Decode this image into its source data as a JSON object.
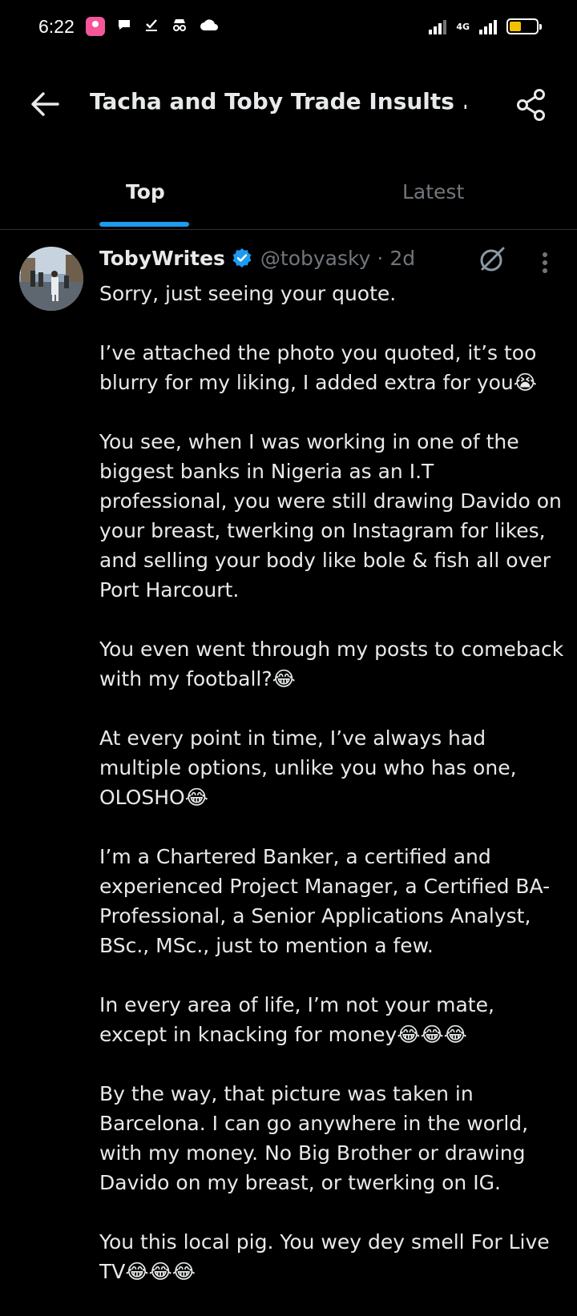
{
  "status_bar": {
    "time": "6:22",
    "network": "4G",
    "battery_level": 0.45,
    "icons": [
      "app-icon",
      "chat-icon",
      "check-icon",
      "incognito-icon",
      "cloud-icon"
    ]
  },
  "header": {
    "title": "Tacha and Toby Trade Insults ..."
  },
  "tabs": [
    {
      "label": "Top",
      "active": true
    },
    {
      "label": "Latest",
      "active": false
    }
  ],
  "tweet": {
    "name": "TobyWrites",
    "handle": "@tobyasky",
    "time": "· 2d",
    "paragraphs": [
      "Sorry, just seeing your quote.",
      "I’ve attached the photo you quoted, it’s too blurry for my liking, I added extra for you😭",
      "You see, when I was working in one of the biggest banks in Nigeria as an I.T professional, you were still drawing Davido on your breast, twerking on Instagram for likes, and selling your body like bole & fish all over Port Harcourt.",
      "You even went through my posts to comeback with my football?😂",
      "At every point in time, I’ve always had multiple options, unlike you who has one, OLOSHO😂",
      "I’m a Chartered Banker, a certified and experienced Project Manager, a Certified BA-Professional, a Senior Applications Analyst, BSc., MSc., just to mention a few.",
      "In every area of life, I’m not your mate, except in knacking for money😂😂😂",
      "By the way, that picture was taken in Barcelona. I can go anywhere in the world, with my money. No Big Brother or drawing Davido on my breast, or twerking on IG.",
      "You this local pig. You wey dey smell For Live TV😂😂😂"
    ]
  },
  "colors": {
    "background": "#000000",
    "accent": "#1d9bf0",
    "muted": "#71767b",
    "text": "#e7e9ea"
  }
}
